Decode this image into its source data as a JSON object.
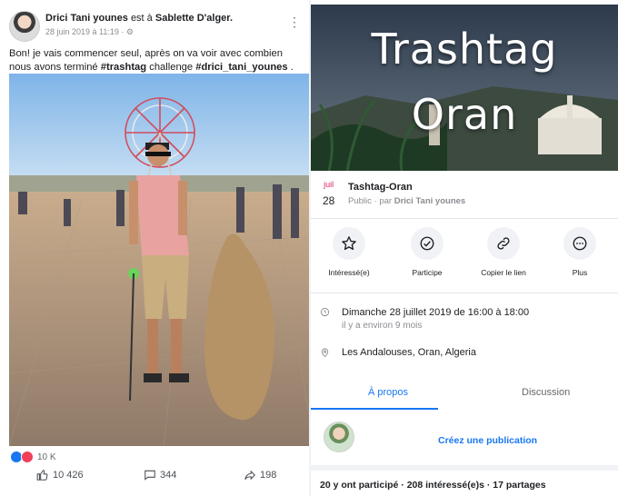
{
  "post": {
    "author": "Drici Tani younes",
    "checkin_prefix": "est à",
    "place": "Sablette D'alger.",
    "timestamp": "28 juin 2019 à 11:19",
    "text_plain": "Bon!  je vais commencer seul,  après on va voir avec combien nous avons terminé ",
    "hashtag1": "#trashtag",
    "text_mid": " challenge ",
    "hashtag2": "#drici_tani_younes",
    "text_end": " .",
    "reaction_count": "10 K",
    "likes": "10 426",
    "comments": "344",
    "shares": "198"
  },
  "event": {
    "cover_line1": "Trashtag",
    "cover_line2": "Oran",
    "month": "juil",
    "day": "28",
    "name": "Tashtag-Oran",
    "visibility": "Public",
    "by_prefix": "· par",
    "host": "Drici Tani younes",
    "buttons": [
      {
        "label": "Intéressé(e)",
        "icon": "star-icon"
      },
      {
        "label": "Participe",
        "icon": "check-circle-icon"
      },
      {
        "label": "Copier le lien",
        "icon": "link-icon"
      },
      {
        "label": "Plus",
        "icon": "more-icon"
      }
    ],
    "datetime": "Dimanche 28 juillet 2019 de 16:00 à 18:00",
    "relative": "il y a environ 9 mois",
    "location": "Les Andalouses, Oran, Algeria",
    "tabs": [
      {
        "label": "À propos"
      },
      {
        "label": "Discussion"
      }
    ],
    "compose_label": "Créez une publication",
    "stats": "20 y ont participé  ·  208 intéressé(e)s  ·  17 partages"
  },
  "colors": {
    "accent": "#1877f2",
    "date_month": "#e0245e",
    "muted": "#8a8d91"
  }
}
